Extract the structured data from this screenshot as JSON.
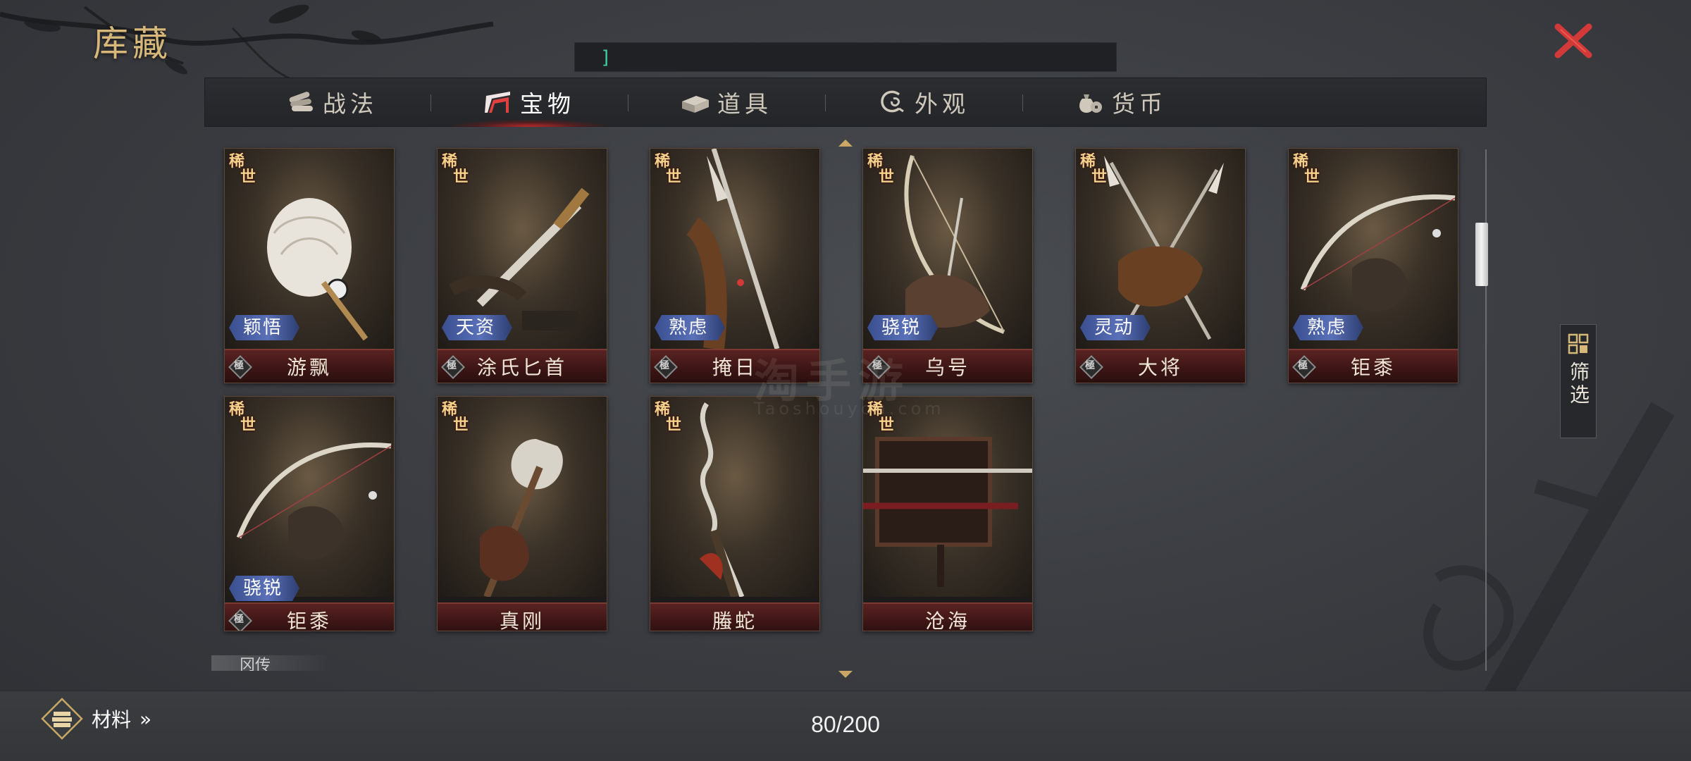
{
  "title": "库藏",
  "search": {
    "value": "",
    "cursor": "]"
  },
  "tabs": [
    {
      "label": "战法",
      "icon": "scroll-bundle-icon",
      "active": false
    },
    {
      "label": "宝物",
      "icon": "treasure-altar-icon",
      "active": true
    },
    {
      "label": "道具",
      "icon": "ingot-box-icon",
      "active": false
    },
    {
      "label": "外观",
      "icon": "swirl-cloud-icon",
      "active": false
    },
    {
      "label": "货币",
      "icon": "money-bag-icon",
      "active": false
    }
  ],
  "rare_label": [
    "稀",
    "世"
  ],
  "grade_label": "極",
  "items": [
    {
      "name": "游飘",
      "trait": "颖悟",
      "rare": true,
      "art": "feather-fan"
    },
    {
      "name": "涂氏匕首",
      "trait": "天资",
      "rare": true,
      "art": "dagger"
    },
    {
      "name": "掩日",
      "trait": "熟虑",
      "rare": true,
      "art": "glaive"
    },
    {
      "name": "乌号",
      "trait": "骁锐",
      "rare": true,
      "art": "bow-dragon"
    },
    {
      "name": "大将",
      "trait": "灵动",
      "rare": true,
      "art": "crossed-spears"
    },
    {
      "name": "钜黍",
      "trait": "熟虑",
      "rare": true,
      "art": "bow"
    },
    {
      "name": "钜黍",
      "trait": "骁锐",
      "rare": true,
      "art": "bow"
    },
    {
      "name": "真刚",
      "trait": "",
      "rare": true,
      "art": "axe"
    },
    {
      "name": "螣蛇",
      "trait": "",
      "rare": true,
      "art": "serpent-spear"
    },
    {
      "name": "沧海",
      "trait": "",
      "rare": true,
      "art": "sword-rack"
    }
  ],
  "section_stub": "冈传",
  "filter": {
    "label": "筛选",
    "icon": "grid-filter-icon"
  },
  "materials": {
    "label": "材料",
    "chevron": "»",
    "icon": "materials-icon"
  },
  "count": "80/200",
  "watermark": {
    "main": "淘手游",
    "sub": "Taoshouyou.com"
  },
  "colors": {
    "accent": "#d8b87a",
    "close": "#d23a3a",
    "trait_blue": "#4a5fa8",
    "name_red": "#4a1b1b",
    "search_text": "#3fd0a0"
  }
}
